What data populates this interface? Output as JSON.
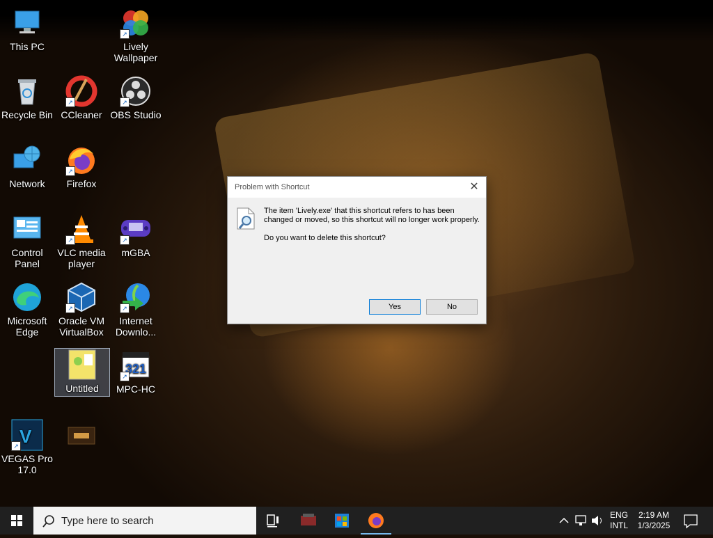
{
  "desktop": {
    "icons": [
      {
        "label": "This PC"
      },
      {
        "label": "Lively Wallpaper"
      },
      {
        "label": "Recycle Bin"
      },
      {
        "label": "CCleaner"
      },
      {
        "label": "OBS Studio"
      },
      {
        "label": "Network"
      },
      {
        "label": "Firefox"
      },
      {
        "label": "Control Panel"
      },
      {
        "label": "VLC media player"
      },
      {
        "label": "mGBA"
      },
      {
        "label": "Microsoft Edge"
      },
      {
        "label": "Oracle VM VirtualBox"
      },
      {
        "label": "Internet Downlo..."
      },
      {
        "label": "Untitled"
      },
      {
        "label": "MPC-HC"
      },
      {
        "label": "VEGAS Pro 17.0"
      },
      {
        "label": ""
      }
    ]
  },
  "dialog": {
    "title": "Problem with Shortcut",
    "message_1": "The item 'Lively.exe' that this shortcut refers to has been changed or moved, so this shortcut will no longer work properly.",
    "message_2": "Do you want to delete this shortcut?",
    "yes_label": "Yes",
    "no_label": "No",
    "close_glyph": "✕"
  },
  "taskbar": {
    "search_placeholder": "Type here to search",
    "language": "ENG",
    "layout": "INTL",
    "time": "2:19 AM",
    "date": "1/3/2025"
  }
}
